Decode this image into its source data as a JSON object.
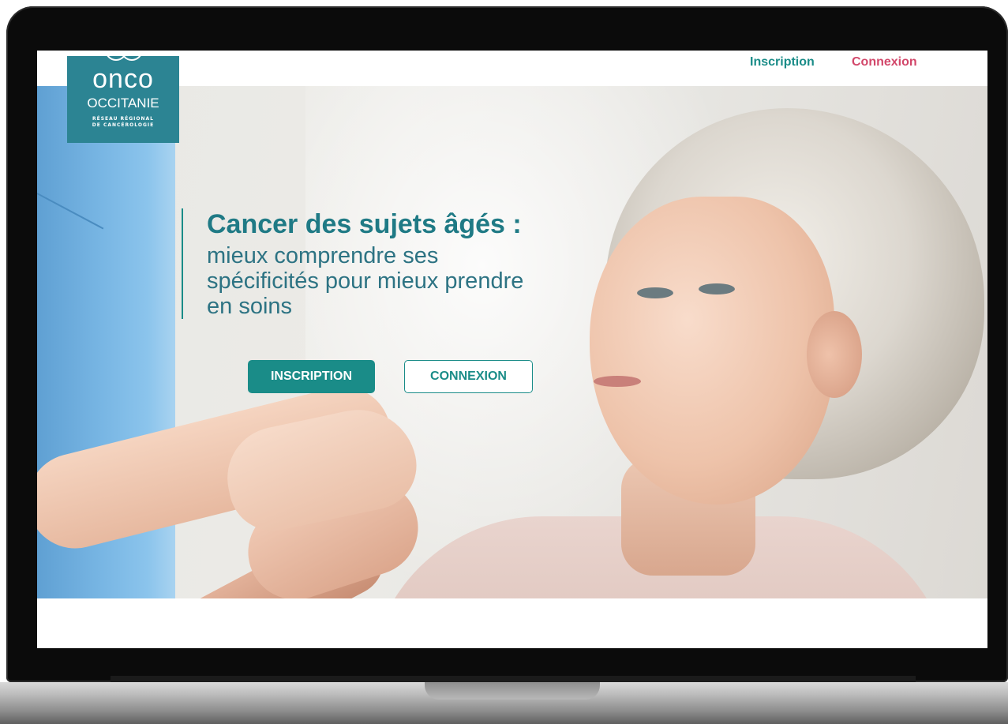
{
  "header": {
    "nav_inscription": "Inscription",
    "nav_connexion": "Connexion"
  },
  "logo": {
    "line1": "onco",
    "line2": "OCCITANIE",
    "line3": "RÉSEAU RÉGIONAL",
    "line4": "DE CANCÉROLOGIE"
  },
  "hero": {
    "title": "Cancer des sujets âgés :",
    "subtitle": "mieux comprendre ses spécificités pour mieux prendre en soins",
    "button_inscription": "INSCRIPTION",
    "button_connexion": "CONNEXION"
  },
  "colors": {
    "teal": "#1a8c88",
    "logo_bg": "#2c8493",
    "pink": "#d2476a"
  }
}
